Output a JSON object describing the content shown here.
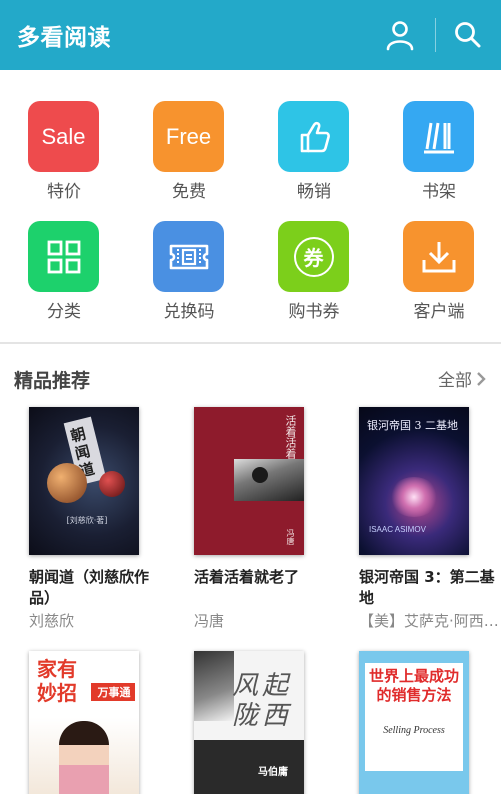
{
  "header": {
    "title": "多看阅读",
    "user_icon": "user-icon",
    "search_icon": "search-icon",
    "bg_color": "#23a9c9"
  },
  "grid": [
    {
      "label": "特价",
      "tile_text": "Sale",
      "icon": "sale-icon",
      "color": "#ee4b4d"
    },
    {
      "label": "免费",
      "tile_text": "Free",
      "icon": "free-icon",
      "color": "#f7932e"
    },
    {
      "label": "畅销",
      "icon": "thumbs-up-icon",
      "color": "#2ec4e6"
    },
    {
      "label": "书架",
      "icon": "bookshelf-icon",
      "color": "#35a8f2"
    },
    {
      "label": "分类",
      "icon": "category-grid-icon",
      "color": "#1dd16c"
    },
    {
      "label": "兑换码",
      "icon": "ticket-icon",
      "color": "#4a90e2"
    },
    {
      "label": "购书券",
      "tile_text": "券",
      "icon": "coupon-icon",
      "color": "#7ccf1b"
    },
    {
      "label": "客户端",
      "icon": "download-icon",
      "color": "#f7932e"
    }
  ],
  "section": {
    "title": "精品推荐",
    "more_label": "全部"
  },
  "books": [
    {
      "title": "朝闻道（刘慈欣作品）",
      "author": "刘慈欣",
      "cover": {
        "title": "朝闻道",
        "author": "[刘慈欣·著]"
      }
    },
    {
      "title": "活着活着就老了",
      "author": "冯唐",
      "cover": {
        "title": "活着活着就老了",
        "author": "冯唐"
      }
    },
    {
      "title": "银河帝国 3：第二基地",
      "author": "【美】艾萨克·阿西莫夫",
      "cover": {
        "title": "银河帝国 3 二基地",
        "author": "ISAAC ASIMOV"
      }
    },
    {
      "title": "",
      "author": "",
      "cover": {
        "title": "家有妙招",
        "subtitle": "万事通"
      }
    },
    {
      "title": "",
      "author": "",
      "cover": {
        "title": "风起陇西",
        "subtitle": "马伯庸"
      }
    },
    {
      "title": "",
      "author": "",
      "cover": {
        "title": "世界上最成功的销售方法",
        "subtitle": "Selling Process"
      }
    }
  ]
}
